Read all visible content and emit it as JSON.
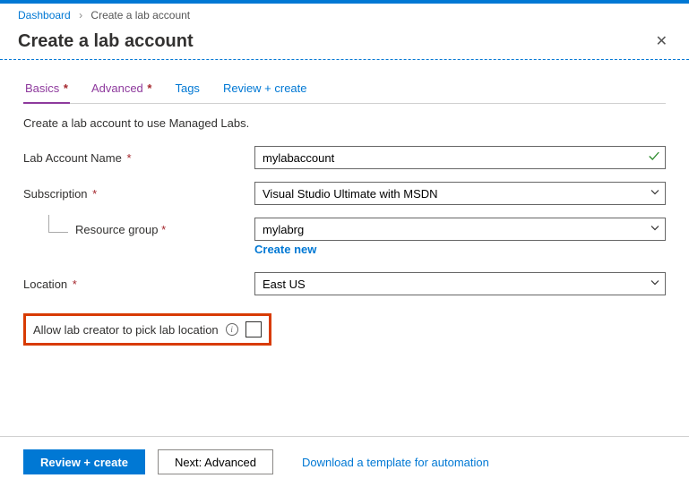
{
  "breadcrumb": {
    "root": "Dashboard",
    "current": "Create a lab account"
  },
  "title": "Create a lab account",
  "tabs": {
    "basics": "Basics",
    "advanced": "Advanced",
    "tags": "Tags",
    "review": "Review + create"
  },
  "description": "Create a lab account to use Managed Labs.",
  "form": {
    "labAccountName": {
      "label": "Lab Account Name",
      "value": "mylabaccount"
    },
    "subscription": {
      "label": "Subscription",
      "value": "Visual Studio Ultimate with MSDN"
    },
    "resourceGroup": {
      "label": "Resource group",
      "value": "mylabrg",
      "createNew": "Create new"
    },
    "location": {
      "label": "Location",
      "value": "East US"
    },
    "allowCreator": {
      "label": "Allow lab creator to pick lab location"
    }
  },
  "footer": {
    "review": "Review + create",
    "next": "Next: Advanced",
    "download": "Download a template for automation"
  }
}
